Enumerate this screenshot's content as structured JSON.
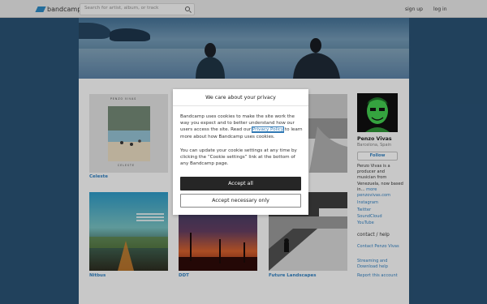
{
  "header": {
    "logo_text": "bandcamp",
    "search_placeholder": "Search for artist, album, or track",
    "signup": "sign up",
    "login": "log in"
  },
  "albums": [
    {
      "title": "Celeste",
      "cover_top": "PENZO VIVAS",
      "cover_bottom": "CELESTE"
    },
    {
      "title": "",
      "cover_top": "",
      "cover_bottom": ""
    },
    {
      "title": "",
      "cover_top": "",
      "cover_bottom": ""
    },
    {
      "title": "Nitbus",
      "cover_top": "",
      "cover_bottom": ""
    },
    {
      "title": "DDT",
      "cover_top": "",
      "cover_bottom": ""
    },
    {
      "title": "Future Landscapes",
      "cover_top": "",
      "cover_bottom": ""
    }
  ],
  "artist": {
    "name": "Penzo Vivas",
    "location": "Barcelona, Spain",
    "follow": "Follow",
    "bio": "Penzo Vivas is a producer and musician from Venezuela, now based in...",
    "more": "more",
    "links": [
      "penzovivas.com",
      "Instagram",
      "Twitter",
      "SoundCloud",
      "YouTube"
    ],
    "contact_heading": "contact / help",
    "contact_links": [
      "Contact Penzo Vivas",
      "Streaming and Download help",
      "Report this account"
    ]
  },
  "cookie_modal": {
    "title": "We care about your privacy",
    "para1_before": "Bandcamp uses cookies to make the site work the way you expect and to better understand how our users access the site. Read our ",
    "privacy_link": "Privacy Policy",
    "para1_after": " to learn more about how Bandcamp uses cookies.",
    "para2": "You can update your cookie settings at any time by clicking the “Cookie settings” link at the bottom of any Bandcamp page.",
    "accept_all": "Accept all",
    "accept_necessary": "Accept necessary only"
  },
  "colors": {
    "brand": "#2a7fb5",
    "link": "#2f78b4",
    "background": "#274c6c",
    "button_dark": "#262626"
  }
}
